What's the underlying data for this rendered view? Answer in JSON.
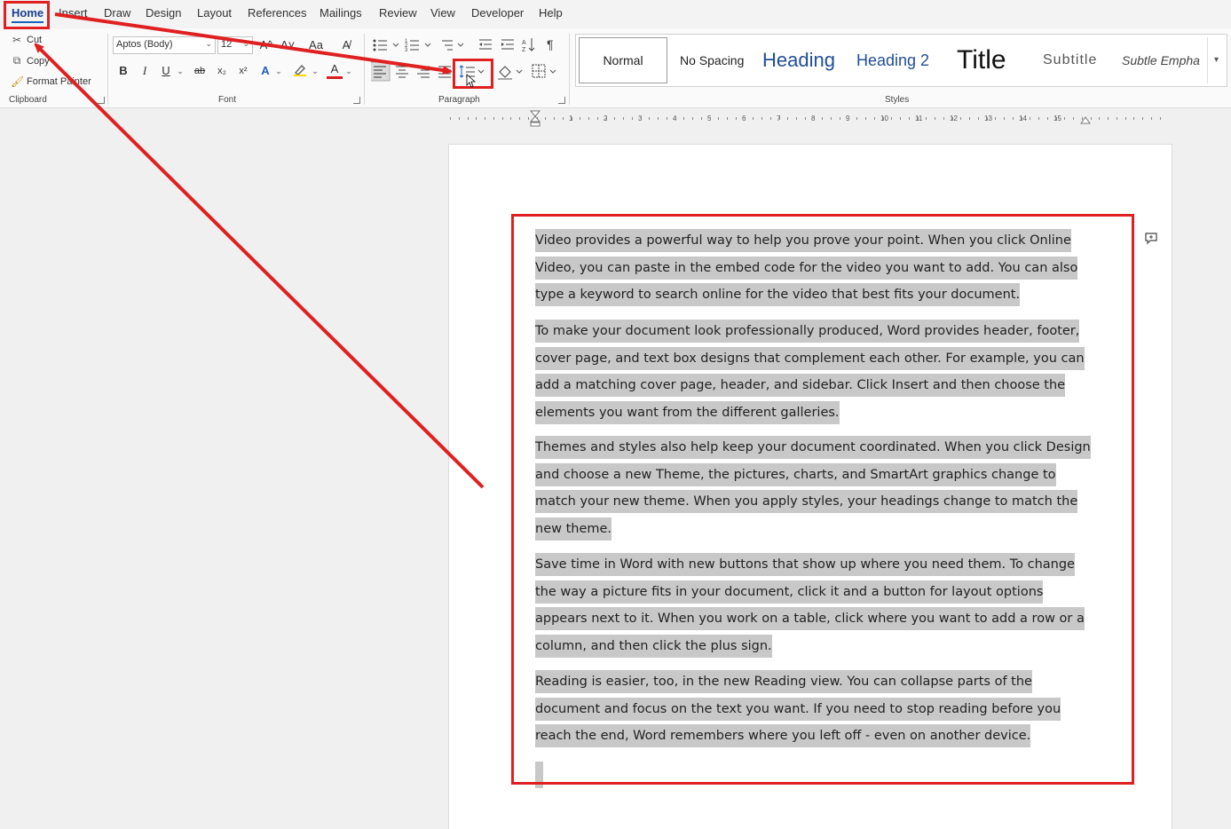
{
  "menu": {
    "tabs": [
      "Home",
      "Insert",
      "Draw",
      "Design",
      "Layout",
      "References",
      "Mailings",
      "Review",
      "View",
      "Developer",
      "Help"
    ]
  },
  "clipboard": {
    "cut": "Cut",
    "copy": "Copy",
    "format_painter": "Format Painter",
    "label": "Clipboard"
  },
  "font": {
    "family": "Aptos (Body)",
    "size": "12",
    "grow": "A^",
    "shrink": "A˅",
    "change_case": "Aa",
    "bold": "B",
    "italic": "I",
    "underline": "U",
    "strike": "ab",
    "subscript": "x₂",
    "superscript": "x²",
    "label": "Font"
  },
  "paragraph": {
    "label": "Paragraph"
  },
  "styles": {
    "items": [
      "Normal",
      "No Spacing",
      "Heading",
      "Heading 2",
      "Title",
      "Subtitle",
      "Subtle Empha"
    ],
    "label": "Styles"
  },
  "ruler": {
    "numbers": [
      "1",
      "2",
      "3",
      "4",
      "5",
      "6",
      "7",
      "8",
      "9",
      "10",
      "11",
      "12",
      "13",
      "14",
      "15"
    ]
  },
  "document": {
    "paragraphs": [
      "Video provides a powerful way to help you prove your point. When you click Online Video, you can paste in the embed code for the video you want to add. You can also type a keyword to search online for the video that best fits your document.",
      "To make your document look professionally produced, Word provides header, footer, cover page, and text box designs that complement each other. For example, you can add a matching cover page, header, and sidebar. Click Insert and then choose the elements you want from the different galleries.",
      "Themes and styles also help keep your document coordinated. When you click Design and choose a new Theme, the pictures, charts, and SmartArt graphics change to match your new theme. When you apply styles, your headings change to match the new theme.",
      "Save time in Word with new buttons that show up where you need them. To change the way a picture fits in your document, click it and a button for layout options appears next to it. When you work on a table, click where you want to add a row or a column, and then click the plus sign.",
      "Reading is easier, too, in the new Reading view. You can collapse parts of the document and focus on the text you want. If you need to stop reading before you reach the end, Word remembers where you left off - even on another device."
    ]
  },
  "colors": {
    "annotation": "#e02020",
    "selection": "#c8c8c8",
    "active_tab": "#1b3f8f"
  }
}
